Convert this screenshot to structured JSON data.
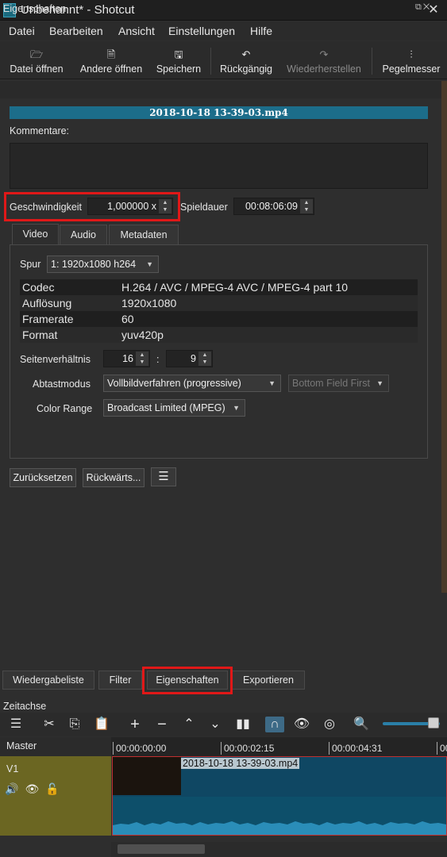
{
  "window": {
    "title": "Unbenannt* - Shotcut",
    "close": "✕"
  },
  "menu": [
    "Datei",
    "Bearbeiten",
    "Ansicht",
    "Einstellungen",
    "Hilfe"
  ],
  "toolbar": {
    "open": {
      "icon": "folder-icon",
      "label": "Datei öffnen"
    },
    "open_other": {
      "icon": "open-other-icon",
      "label": "Andere öffnen"
    },
    "save": {
      "icon": "save-icon",
      "label": "Speichern"
    },
    "undo": {
      "icon": "undo-icon",
      "label": "Rückgängig"
    },
    "redo": {
      "icon": "redo-icon",
      "label": "Wiederherstellen"
    },
    "peak": {
      "icon": "peak-meter-icon",
      "label": "Pegelmesser"
    }
  },
  "properties": {
    "panel_title": "Eigenschaften",
    "file_name": "2018-10-18 13-39-03.mp4",
    "comments_label": "Kommentare:",
    "speed_label": "Geschwindigkeit",
    "speed_value": "1,000000 x",
    "duration_label": "Spieldauer",
    "duration_value": "00:08:06:09",
    "tabs": [
      "Video",
      "Audio",
      "Metadaten"
    ],
    "track_label": "Spur",
    "track_value": "1: 1920x1080 h264",
    "info": [
      {
        "key": "Codec",
        "value": "H.264 / AVC / MPEG-4 AVC / MPEG-4 part 10"
      },
      {
        "key": "Auflösung",
        "value": "1920x1080"
      },
      {
        "key": "Framerate",
        "value": "60"
      },
      {
        "key": "Format",
        "value": "yuv420p"
      }
    ],
    "aspect_label": "Seitenverhältnis",
    "aspect_num": "16",
    "aspect_sep": ":",
    "aspect_den": "9",
    "scan_label": "Abtastmodus",
    "scan_value": "Vollbildverfahren (progressive)",
    "field_value": "Bottom Field First",
    "range_label": "Color Range",
    "range_value": "Broadcast Limited (MPEG)",
    "reset_btn": "Zurücksetzen",
    "reverse_btn": "Rückwärts...",
    "menu_btn": "☰"
  },
  "bottom_tabs": [
    "Wiedergabeliste",
    "Filter",
    "Eigenschaften",
    "Exportieren"
  ],
  "timeline": {
    "title": "Zeitachse",
    "master": "Master",
    "track": "V1",
    "ticks": [
      "00:00:00:00",
      "00:00:02:15",
      "00:00:04:31",
      "00"
    ],
    "clip_name": "2018-10-18 13-39-03.mp4"
  },
  "colors": {
    "highlight": "#e01818",
    "accent": "#1c6d8a",
    "track_head": "#6b6622",
    "clip": "#0f4763"
  }
}
